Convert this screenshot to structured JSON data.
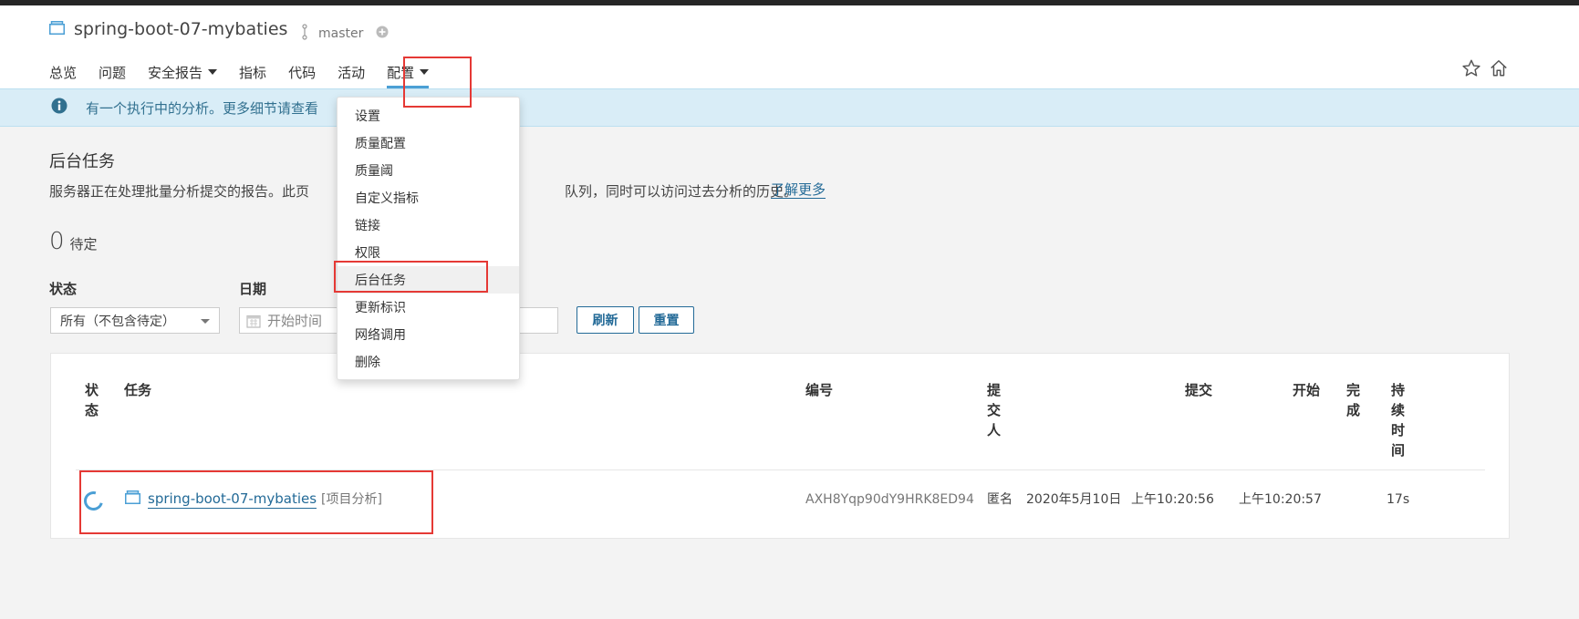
{
  "project": {
    "name": "spring-boot-07-mybaties",
    "branch": "master"
  },
  "nav": {
    "items": [
      {
        "label": "总览",
        "dropdown": false,
        "active": false
      },
      {
        "label": "问题",
        "dropdown": false,
        "active": false
      },
      {
        "label": "安全报告",
        "dropdown": true,
        "active": false
      },
      {
        "label": "指标",
        "dropdown": false,
        "active": false
      },
      {
        "label": "代码",
        "dropdown": false,
        "active": false
      },
      {
        "label": "活动",
        "dropdown": false,
        "active": false
      },
      {
        "label": "配置",
        "dropdown": true,
        "active": true
      }
    ]
  },
  "banner": {
    "message": "有一个执行中的分析。更多细节请查看"
  },
  "page": {
    "title": "后台任务",
    "desc_left": "服务器正在处理批量分析提交的报告。此页",
    "desc_right": "队列，同时可以访问过去分析的历史。",
    "learn_more": "了解更多"
  },
  "pending": {
    "count": "0",
    "label": "待定"
  },
  "filters": {
    "status_label": "状态",
    "status_value": "所有（不包含待定）",
    "date_label": "日期",
    "date_placeholder": "开始时间",
    "refresh_label": "刷新",
    "reset_label": "重置"
  },
  "table": {
    "headers": {
      "status": "状\n态",
      "task": "任务",
      "id": "编号",
      "submitter": "提\n交\n人",
      "submitted": "提交",
      "started": "开始",
      "finished": "完\n成",
      "duration": "持\n续\n时\n间"
    },
    "rows": [
      {
        "task": "spring-boot-07-mybaties",
        "type": "[项目分析]",
        "id": "AXH8Yqp90dY9HRK8ED94",
        "submitter": "匿名",
        "date": "2020年5月10日",
        "submitted_time": "上午10:20:56",
        "started_time": "上午10:20:57",
        "finished": "",
        "duration": "17s"
      }
    ]
  },
  "dropdown_menu": {
    "items": [
      "设置",
      "质量配置",
      "质量阈",
      "自定义指标",
      "链接",
      "权限",
      "后台任务",
      "更新标识",
      "网络调用",
      "删除"
    ],
    "highlighted": "后台任务"
  },
  "colors": {
    "link": "#236a97",
    "accent": "#4b9fd5",
    "banner_bg": "#d9edf7",
    "annotation": "#e53935"
  }
}
